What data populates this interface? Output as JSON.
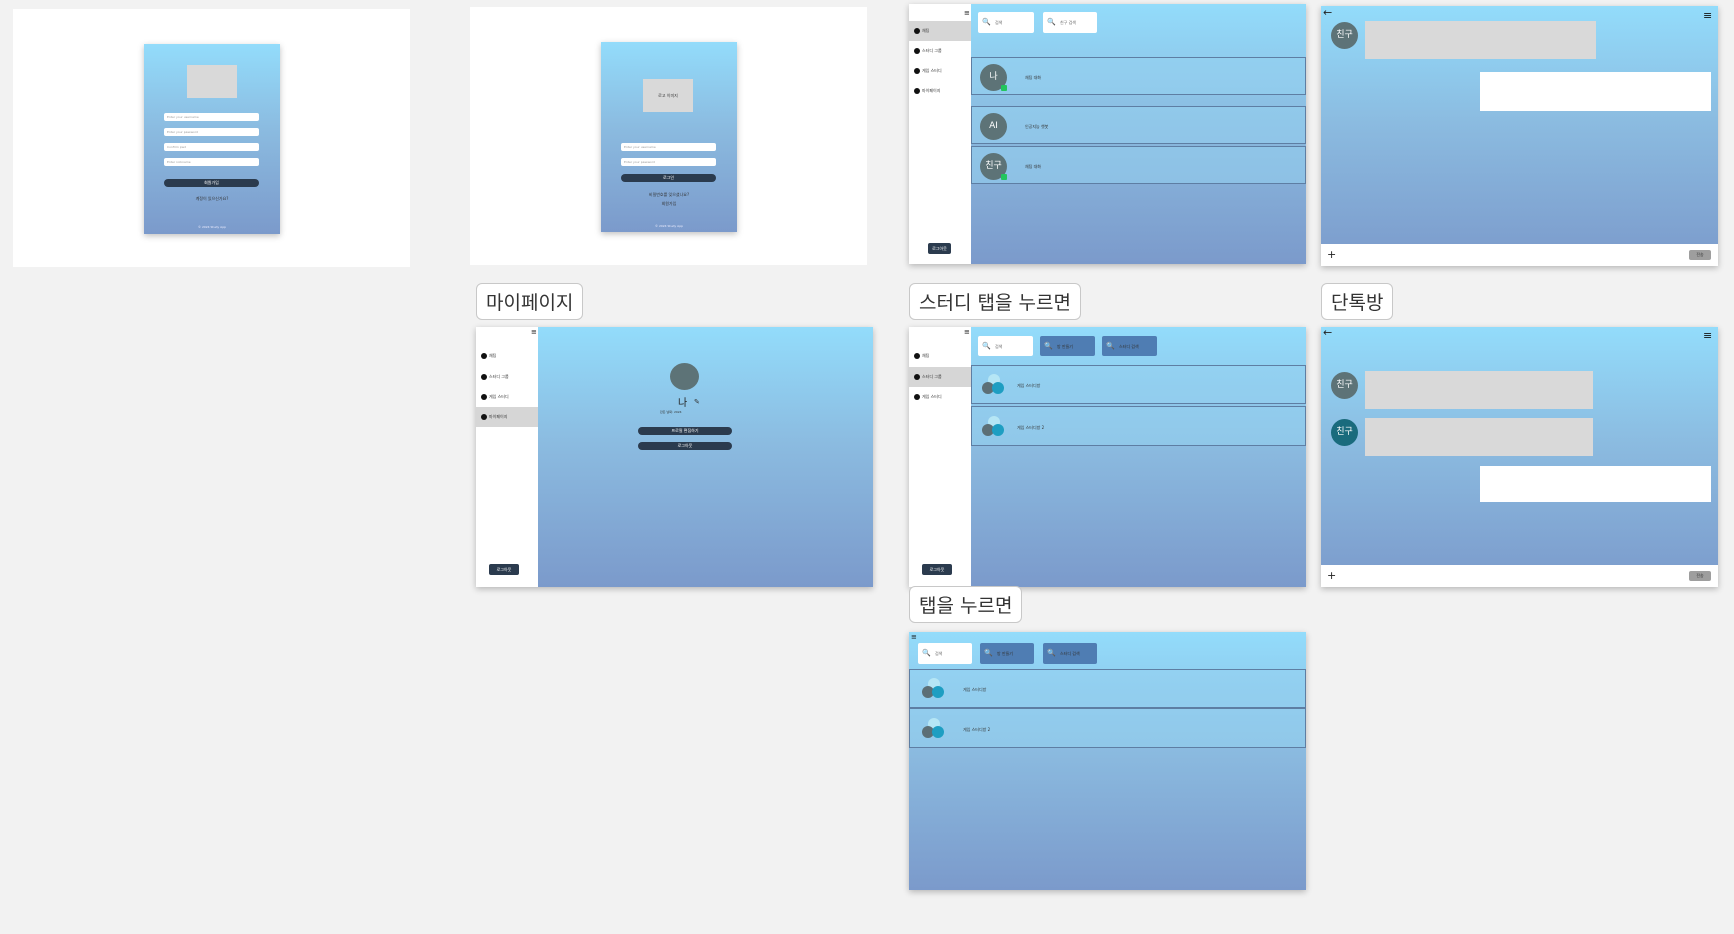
{
  "labels": {
    "mypage": "마이페이지",
    "study_tab": "스터디 탭을 누르면",
    "dm_room": "단톡방",
    "tab_press": "탭을 누르면"
  },
  "login": {
    "inputs": [
      "Enter your username",
      "Enter your password",
      "Confirm pwd",
      "Enter nickname"
    ],
    "button": "회원가입",
    "link": "계정이 있으신가요?",
    "footer": "© 2024 Study App"
  },
  "login2": {
    "logo_text": "로고 이미지",
    "inputs": [
      "Enter your username",
      "Enter your password"
    ],
    "button": "로그인",
    "links": [
      "비밀번호를 잊으셨나요?",
      "회원가입"
    ],
    "footer": "© 2024 Study App"
  },
  "sidebar": {
    "items": [
      "채팅",
      "스터디 그룹",
      "게임 스터디",
      "마이페이지"
    ],
    "logout": "로그아웃"
  },
  "chatlist": {
    "search_placeholder": "검색",
    "search2_placeholder": "친구 검색",
    "rows": [
      {
        "avatar": "나",
        "text": "채팅 대화"
      },
      {
        "avatar": "AI",
        "text": "인공지능 챗봇"
      },
      {
        "avatar": "친구",
        "text": "채팅 대화"
      }
    ]
  },
  "mypage": {
    "name": "나",
    "edit_icon": "pencil-icon",
    "sub": "만든 날짜: 2024",
    "buttons": [
      "프로필 편집하기",
      "로그아웃"
    ]
  },
  "study": {
    "search_placeholder": "검색",
    "btn1": "방 만들기",
    "btn2": "스터디 검색",
    "rows": [
      "게임 스터디방",
      "게임 스터디방 2"
    ]
  },
  "chatroom": {
    "friend": "친구",
    "send": "전송",
    "plus": "+",
    "back": "←"
  }
}
